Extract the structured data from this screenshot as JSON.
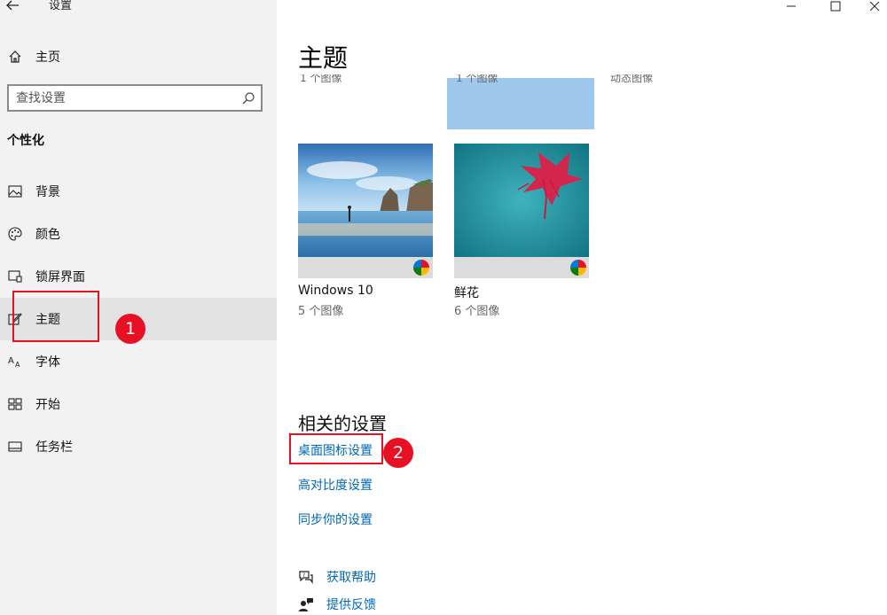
{
  "window": {
    "title": "设置",
    "controls": [
      "minimize-icon",
      "maximize-icon",
      "close-icon"
    ]
  },
  "sidebar": {
    "home_label": "主页",
    "search_placeholder": "查找设置",
    "section_label": "个性化",
    "items": [
      {
        "label": "背景",
        "icon": "picture-icon"
      },
      {
        "label": "颜色",
        "icon": "palette-icon"
      },
      {
        "label": "锁屏界面",
        "icon": "lock-screen-icon"
      },
      {
        "label": "主题",
        "icon": "brush-icon",
        "selected": true
      },
      {
        "label": "字体",
        "icon": "font-icon"
      },
      {
        "label": "开始",
        "icon": "start-icon"
      },
      {
        "label": "任务栏",
        "icon": "taskbar-icon"
      }
    ]
  },
  "annotations": {
    "step1": "1",
    "step2": "2",
    "color": "#e81123"
  },
  "main": {
    "page_title": "主题",
    "cut_off_row": [
      {
        "subtitle": "1 个图像"
      },
      {
        "subtitle": "1 个图像"
      },
      {
        "subtitle": "动态图像"
      }
    ],
    "themes": [
      {
        "name": "Windows 10",
        "count": "5 个图像"
      },
      {
        "name": "鲜花",
        "count": "6 个图像"
      }
    ],
    "related_title": "相关的设置",
    "links": {
      "desktop_icons": "桌面图标设置",
      "high_contrast": "高对比度设置",
      "sync": "同步你的设置"
    },
    "help": {
      "get_help": "获取帮助",
      "feedback": "提供反馈"
    },
    "colors": {
      "link": "#0067b8",
      "selected_bg": "#e3e3e3",
      "sidebar_bg": "#f2f2f2"
    }
  }
}
